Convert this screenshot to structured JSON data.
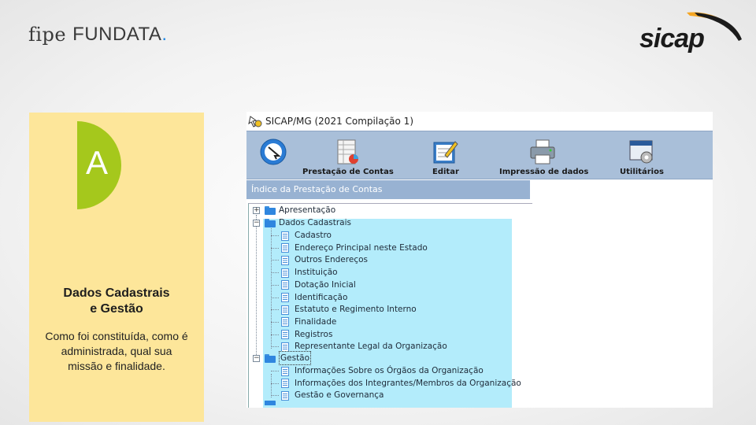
{
  "branding": {
    "left_logo_prefix": "fipe",
    "left_logo_name": "FUNDATA",
    "left_logo_dot": ".",
    "right_logo": "sicap",
    "accent_blue": "#1e88e5",
    "accent_orange": "#f5a623"
  },
  "card": {
    "badge_letter": "A",
    "badge_color": "#a5c81c",
    "background": "#fde69a",
    "heading_line1": "Dados Cadastrais",
    "heading_line2": "e Gestão",
    "description": "Como foi constituída, como é administrada, qual sua missão e finalidade."
  },
  "window": {
    "title": "SICAP/MG (2021 Compilação 1)",
    "toolbar": [
      {
        "label": "",
        "icon": "arrow-cursor-icon"
      },
      {
        "label": "Prestação de Contas",
        "icon": "spreadsheet-chart-icon"
      },
      {
        "label": "Editar",
        "icon": "edit-document-icon"
      },
      {
        "label": "Impressão de dados",
        "icon": "printer-icon"
      },
      {
        "label": "Utilitários",
        "icon": "gear-window-icon"
      }
    ],
    "index_header": "Índice da Prestação de Contas",
    "tree": {
      "apresentacao": "Apresentação",
      "dados_cadastrais": "Dados Cadastrais",
      "dados_items": [
        "Cadastro",
        "Endereço Principal neste Estado",
        "Outros Endereços",
        "Instituição",
        "Dotação Inicial",
        "Identificação",
        "Estatuto e Regimento Interno",
        "Finalidade",
        "Registros",
        "Representante Legal da Organização"
      ],
      "gestao": "Gestão",
      "gestao_items": [
        "Informações Sobre os Órgãos da Organização",
        "Informações dos Integrantes/Membros da Organização",
        "Gestão e Governança"
      ]
    }
  }
}
